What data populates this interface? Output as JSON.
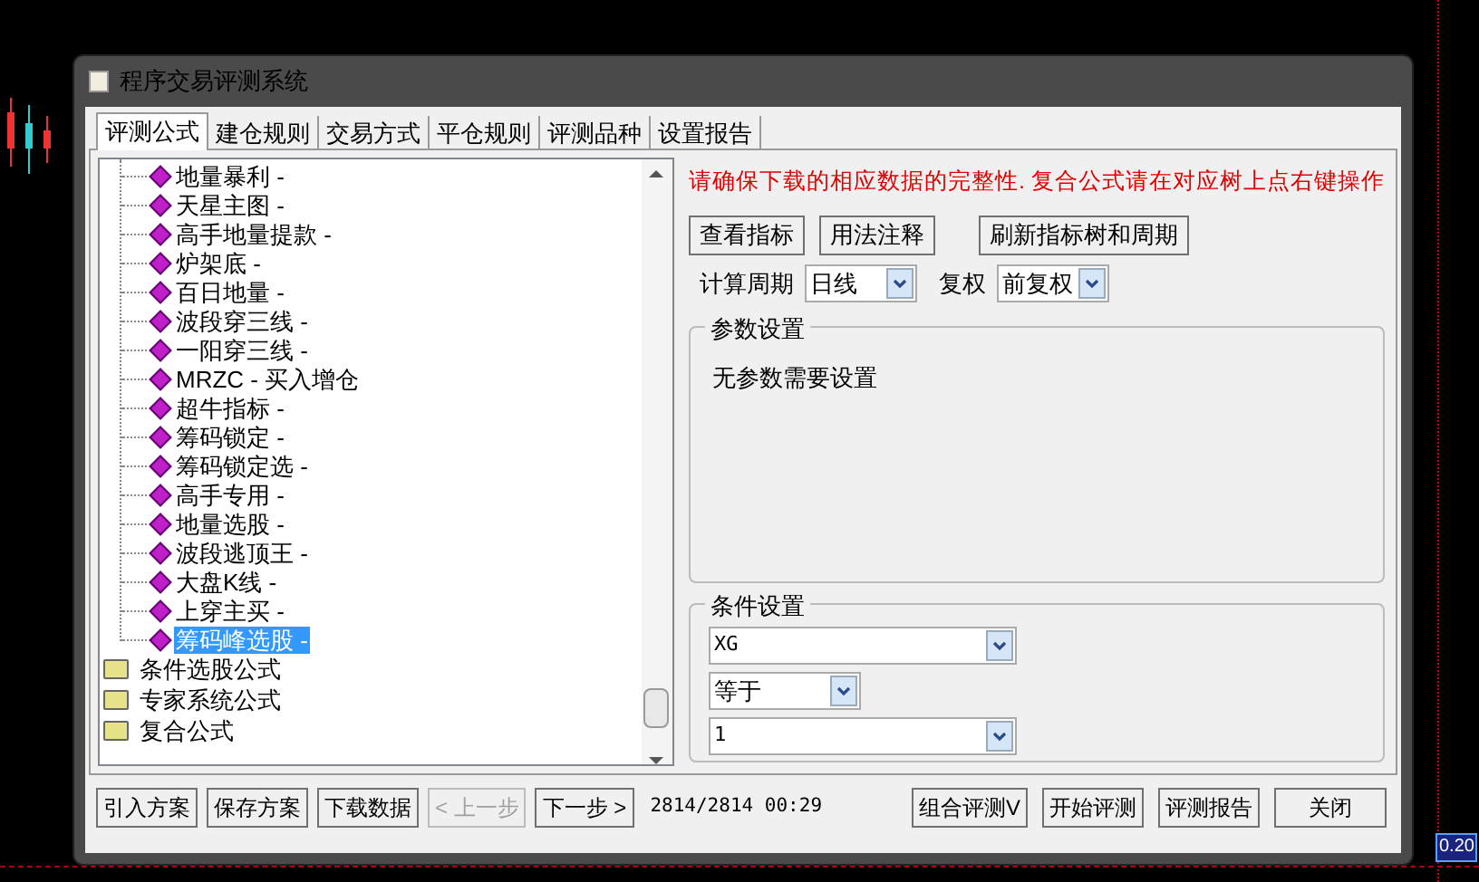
{
  "window": {
    "title": "程序交易评测系统"
  },
  "tabs": [
    {
      "label": "评测公式",
      "selected": true
    },
    {
      "label": "建仓规则",
      "selected": false
    },
    {
      "label": "交易方式",
      "selected": false
    },
    {
      "label": "平仓规则",
      "selected": false
    },
    {
      "label": "评测品种",
      "selected": false
    },
    {
      "label": "设置报告",
      "selected": false
    }
  ],
  "tree": [
    {
      "kind": "formula",
      "label": "地量暴利 -",
      "selected": false
    },
    {
      "kind": "formula",
      "label": "天星主图 -",
      "selected": false
    },
    {
      "kind": "formula",
      "label": "高手地量提款 -",
      "selected": false
    },
    {
      "kind": "formula",
      "label": "炉架底 -",
      "selected": false
    },
    {
      "kind": "formula",
      "label": "百日地量 -",
      "selected": false
    },
    {
      "kind": "formula",
      "label": "波段穿三线 -",
      "selected": false
    },
    {
      "kind": "formula",
      "label": "一阳穿三线 -",
      "selected": false
    },
    {
      "kind": "formula",
      "label": "MRZC - 买入增仓",
      "selected": false
    },
    {
      "kind": "formula",
      "label": "超牛指标 -",
      "selected": false
    },
    {
      "kind": "formula",
      "label": "筹码锁定 -",
      "selected": false
    },
    {
      "kind": "formula",
      "label": "筹码锁定选 -",
      "selected": false
    },
    {
      "kind": "formula",
      "label": "高手专用 -",
      "selected": false
    },
    {
      "kind": "formula",
      "label": "地量选股 -",
      "selected": false
    },
    {
      "kind": "formula",
      "label": "波段逃顶王 -",
      "selected": false
    },
    {
      "kind": "formula",
      "label": "大盘K线 -",
      "selected": false
    },
    {
      "kind": "formula",
      "label": "上穿主买 -",
      "selected": false
    },
    {
      "kind": "formula",
      "label": "筹码峰选股 -",
      "selected": true
    },
    {
      "kind": "folder",
      "label": "条件选股公式",
      "selected": false
    },
    {
      "kind": "folder",
      "label": "专家系统公式",
      "selected": false
    },
    {
      "kind": "folder",
      "label": "复合公式",
      "selected": false
    }
  ],
  "notice": "请确保下载的相应数据的完整性. 复合公式请在对应树上点右键操作",
  "tool_buttons": [
    "查看指标",
    "用法注释",
    "刷新指标树和周期"
  ],
  "period": {
    "label": "计算周期",
    "value": "日线"
  },
  "adjust": {
    "label": "复权",
    "value": "前复权"
  },
  "params": {
    "title": "参数设置",
    "text": "无参数需要设置"
  },
  "conditions": {
    "title": "条件设置",
    "indicator": "XG",
    "operator": "等于",
    "value": "1"
  },
  "bottom_buttons": [
    {
      "label": "引入方案",
      "disabled": false
    },
    {
      "label": "保存方案",
      "disabled": false
    },
    {
      "label": "下载数据",
      "disabled": false
    },
    {
      "label": "< 上一步",
      "disabled": true
    },
    {
      "label": "下一步 >",
      "disabled": false
    }
  ],
  "progress": "2814/2814 00:29",
  "action_buttons": [
    "组合评测V",
    "开始评测",
    "评测报告",
    "关闭"
  ],
  "chart_value": "0.20"
}
